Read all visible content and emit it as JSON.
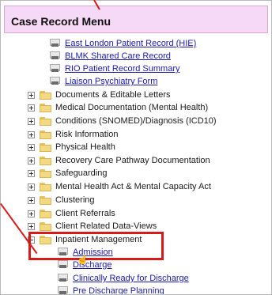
{
  "header": {
    "title": "Case Record Menu"
  },
  "tree": {
    "links": [
      "East London Patient Record (HIE)",
      "BLMK Shared Care Record",
      "RIO Patient Record Summary",
      "Liaison Psychiatry Form"
    ],
    "folders": [
      "Documents & Editable Letters",
      "Medical Documentation (Mental Health)",
      "Conditions (SNOMED)/Diagnosis (ICD10)",
      "Risk Information",
      "Physical Health",
      "Recovery Care Pathway Documentation",
      "Safeguarding",
      "Mental Health Act & Mental Capacity Act",
      "Clustering",
      "Client Referrals",
      "Client Related Data-Views",
      "Inpatient Management"
    ],
    "inpatient_children": [
      "Admission",
      "Discharge",
      "Clinically Ready for Discharge",
      "Pre Discharge Planning"
    ]
  },
  "colors": {
    "header_bg": "#f6d9f6",
    "highlight": "#d61b1b",
    "link": "#1a1aa6"
  }
}
